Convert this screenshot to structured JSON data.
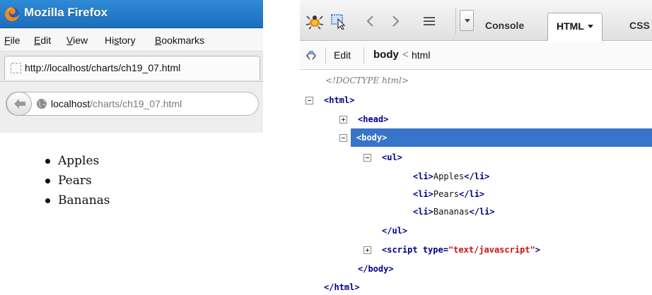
{
  "firefox": {
    "title": "Mozilla Firefox",
    "menu": [
      "File",
      "Edit",
      "View",
      "History",
      "Bookmarks"
    ],
    "menu_mnemonics": [
      "F",
      "E",
      "V",
      "s",
      "B"
    ],
    "tab_title": "http://localhost/charts/ch19_07.html",
    "url_host": "localhost",
    "url_path": "/charts/ch19_07.html"
  },
  "page": {
    "items": [
      "Apples",
      "Pears",
      "Bananas"
    ]
  },
  "firebug": {
    "tabs": {
      "console": "Console",
      "html": "HTML",
      "css": "CSS"
    },
    "toolbar": {
      "edit": "Edit",
      "crumb_current": "body",
      "crumb_sep": "<",
      "crumb_parent": "html"
    },
    "tree": {
      "doctype": "<!DOCTYPE html>",
      "html_open": "<html>",
      "head": "<head>",
      "body_open": "<body>",
      "ul_open": "<ul>",
      "li_open": "<li>",
      "li_close": "</li>",
      "li_items": [
        "Apples",
        "Pears",
        "Bananas"
      ],
      "ul_close": "</ul>",
      "script_tag": "<script",
      "script_attr": "type=",
      "script_val": "\"text/javascript\"",
      "script_end": ">",
      "body_close": "</body>",
      "html_close": "</html>"
    },
    "selected_color": "#3874c9"
  }
}
